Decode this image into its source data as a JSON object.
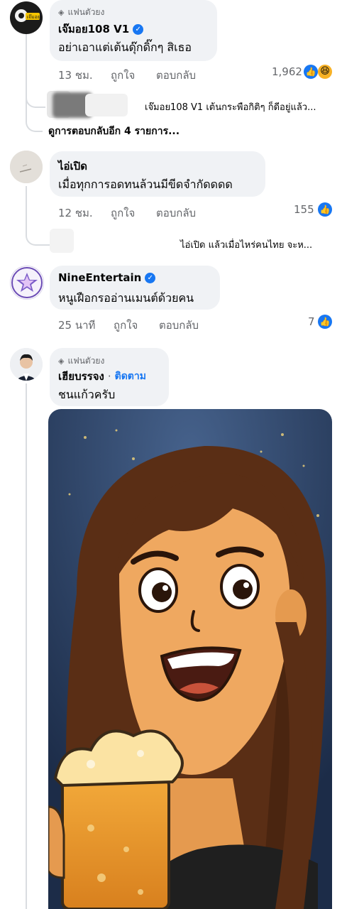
{
  "comments": [
    {
      "fan_badge": "แฟนตัวยง",
      "name": "เจ๊มอย108 V1",
      "text": "อย่าเอาแต่เต้นดุ๊กดิ๊กๆ สิเธอ",
      "time": "13 ชม.",
      "like_label": "ถูกใจ",
      "reply_label": "ตอบกลับ",
      "reaction_count": "1,962",
      "reactions": [
        "like-icon",
        "haha-icon"
      ],
      "avatar_text": "เจ๊มอย",
      "reply_preview": {
        "author": "เจ๊มอย108 V1",
        "text": "เต้นกระพือกิติๆ ก็ดีอยู่แล้ว..."
      },
      "more_replies": "ดูการตอบกลับอีก 4 รายการ..."
    },
    {
      "name": "ไอ่เปิด",
      "text": "เมื่อทุกการอดทนล้วนมีขีดจำกัดดดด",
      "time": "12 ชม.",
      "like_label": "ถูกใจ",
      "reply_label": "ตอบกลับ",
      "reaction_count": "155",
      "reactions": [
        "like-icon"
      ],
      "reply_preview": {
        "author": "ไอ่เปิด",
        "text": "แล้วเมื่อไหร่คนไทย จะห..."
      }
    },
    {
      "name": "NineEntertain",
      "text": "หนูเฝือกรออ่านเมนต์ด้วยคน",
      "time": "25 นาที",
      "like_label": "ถูกใจ",
      "reply_label": "ตอบกลับ",
      "reaction_count": "7",
      "reactions": [
        "like-icon"
      ]
    },
    {
      "fan_badge": "แฟนตัวยง",
      "name": "เฮียบรรจง",
      "follow_label": "ติดตาม",
      "text": "ชนแก้วครับ"
    }
  ],
  "colors": {
    "bubble": "#f0f2f5",
    "secondary_text": "#65676b",
    "facebook_blue": "#1877f2"
  }
}
